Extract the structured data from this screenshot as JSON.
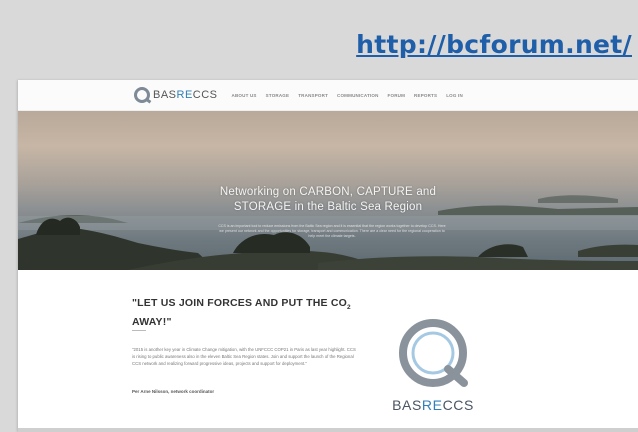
{
  "url": "http://bcforum.net/",
  "site": {
    "logo": {
      "part1": "BAS",
      "part2": "RE",
      "part3": "CCS"
    },
    "nav": [
      "ABOUT US",
      "STORAGE",
      "TRANSPORT",
      "COMMUNICATION",
      "FORUM",
      "REPORTS",
      "LOG IN"
    ],
    "hero": {
      "title_line1": "Networking on CARBON, CAPTURE and",
      "title_line2": "STORAGE in the Baltic Sea Region",
      "body": "CCS is an important tool to reduce emissions from the Baltic Sea region and it is essential that the region works together to develop CCS. Here we present our network and the opportunities for storage, transport and communication. There are a clear need for the regional cooperation to help meet the climate targets."
    },
    "quote": {
      "title_main": "\"LET US JOIN FORCES AND PUT THE CO",
      "title_sub": "2",
      "title_end": " AWAY!\"",
      "body": "\"2015 is another key year in Climate Change mitigation, with the UNFCCC COP21 in Paris as last year highlight. CCS is rising to public awareness also in the eleven Baltic Sea Region states. Join and support the launch of the Regional CCS network and realizing forward progressive ideas, projects and support for deployment.\"",
      "author": "Per Arne Nilsson, network coordinator"
    }
  }
}
